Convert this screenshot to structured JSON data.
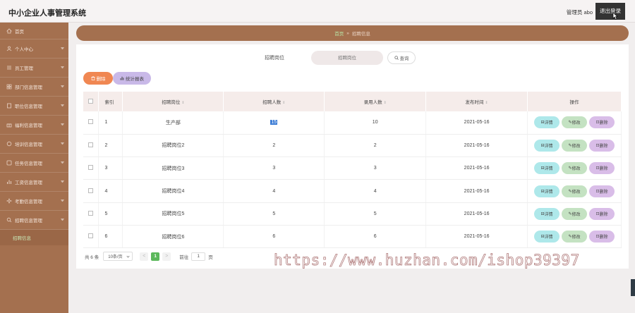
{
  "app": {
    "title": "中小企业人事管理系统",
    "admin_label": "管理员 abo",
    "logout_label": "退出登录"
  },
  "sidebar": {
    "items": [
      {
        "label": "首页",
        "icon": "home-icon"
      },
      {
        "label": "个人中心",
        "icon": "user-icon"
      },
      {
        "label": "员工管理",
        "icon": "list-icon"
      },
      {
        "label": "部门信息管理",
        "icon": "grid-icon"
      },
      {
        "label": "职位信息管理",
        "icon": "doc-icon"
      },
      {
        "label": "福利信息管理",
        "icon": "gift-icon"
      },
      {
        "label": "培训信息管理",
        "icon": "book-icon"
      },
      {
        "label": "任务信息管理",
        "icon": "task-icon"
      },
      {
        "label": "工资信息管理",
        "icon": "chart-icon"
      },
      {
        "label": "考勤信息管理",
        "icon": "clock-icon"
      },
      {
        "label": "招聘信息管理",
        "icon": "search-icon"
      }
    ],
    "active_sub": "招聘信息"
  },
  "breadcrumb": {
    "home": "首页",
    "separator": "»",
    "current": "招聘信息"
  },
  "search": {
    "label": "招聘岗位",
    "placeholder": "招聘岗位",
    "button_label": "查询"
  },
  "toolbar": {
    "delete_label": "删除",
    "report_label": "统计报表"
  },
  "table": {
    "headers": {
      "index": "索引",
      "position": "招聘岗位",
      "hire_count": "招聘人数",
      "accepted_count": "录用人数",
      "publish_time": "发布时间",
      "actions": "操作"
    },
    "action_labels": {
      "detail": "详情",
      "edit": "修改",
      "delete": "删除"
    },
    "rows": [
      {
        "index": "1",
        "position": "生产部",
        "hire_count": "15",
        "accepted_count": "10",
        "publish_time": "2021-05-16"
      },
      {
        "index": "2",
        "position": "招聘岗位2",
        "hire_count": "2",
        "accepted_count": "2",
        "publish_time": "2021-05-16"
      },
      {
        "index": "3",
        "position": "招聘岗位3",
        "hire_count": "3",
        "accepted_count": "3",
        "publish_time": "2021-05-16"
      },
      {
        "index": "4",
        "position": "招聘岗位4",
        "hire_count": "4",
        "accepted_count": "4",
        "publish_time": "2021-05-16"
      },
      {
        "index": "5",
        "position": "招聘岗位5",
        "hire_count": "5",
        "accepted_count": "5",
        "publish_time": "2021-05-16"
      },
      {
        "index": "6",
        "position": "招聘岗位6",
        "hire_count": "6",
        "accepted_count": "6",
        "publish_time": "2021-05-16"
      }
    ]
  },
  "pagination": {
    "total": "共 6 条",
    "page_size": "10条/页",
    "prev": "<",
    "current_page": "1",
    "next": ">",
    "goto_label": "前往",
    "goto_value": "1",
    "page_suffix": "页"
  },
  "watermark": "https://www.huzhan.com/ishop39397",
  "colors": {
    "sidebar": "#a4704f",
    "accent_green": "#5cb85c",
    "delete_orange": "#f08752",
    "report_purple": "#c9b9e8"
  }
}
